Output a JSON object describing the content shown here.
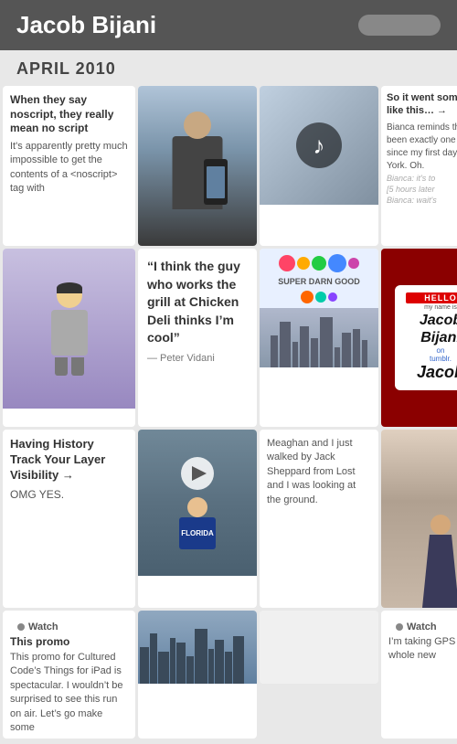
{
  "header": {
    "title": "Jacob Bijani",
    "search_placeholder": ""
  },
  "section": {
    "month_label": "APRIL 2010"
  },
  "cards": {
    "card1": {
      "title": "When they say noscript, they really mean no script",
      "body": "It's apparently pretty much impossible to get the contents of a <noscript> tag with"
    },
    "card_photo_man": {
      "alt": "Man holding phone"
    },
    "card_music": {
      "alt": "Music note over city"
    },
    "card_stickers": {
      "alt": "Colorful stickers"
    },
    "card_quote": {
      "quote": "“I think the guy who works the grill at Chicken Deli thinks I’m cool”",
      "attribution": "— Peter Vidani"
    },
    "card_avatar": {
      "alt": "3D avatar figure"
    },
    "card_layer": {
      "title": "Having History Track Your Layer Visibility →",
      "body": "OMG YES."
    },
    "card_so_it_went": {
      "title": "So it went something like this… →",
      "chat": [
        {
          "speaker": "Bianca",
          "text": "Bianca reminds that it has been exactly one year since my first day in New York. Oh."
        },
        {
          "label": "Bianca: it’s to"
        },
        {
          "label": "[5 hours later"
        },
        {
          "label": "Bianca: wait’s"
        }
      ]
    },
    "card_badge": {
      "hello": "HELLO",
      "my_name_is": "my name is",
      "name_line1": "Jacob Bijani",
      "name_line2": "on",
      "tumblr": "tumblr.",
      "name_line3": "Jacob"
    },
    "card_watch1": {
      "label": "Watch",
      "title": "This promo for Cultured Code’s Things for iPad is spectacular. I wouldn’t be surprised to see this run on air. Let’s go make some"
    },
    "card_kid": {
      "alt": "Kid in car with Florida shirt"
    },
    "card_meaghan": {
      "body": "Meaghan and I just walked by Jack Sheppard from Lost and I was looking at the ground."
    },
    "card_watch2": {
      "label": "Watch",
      "title": "I’m taking GPS to a whole new"
    },
    "card_woman": {
      "alt": "Woman standing"
    },
    "card_city": {
      "alt": "City buildings"
    }
  },
  "colors": {
    "header_bg": "#555555",
    "header_text": "#ffffff",
    "accent_blue": "#5b8dd9",
    "section_text": "#444444",
    "card_bg": "#ffffff",
    "body_bg": "#e8e8e8"
  }
}
